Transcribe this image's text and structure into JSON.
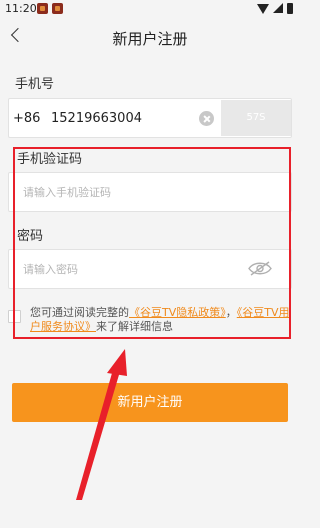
{
  "status_bar": {
    "time": "11:20"
  },
  "nav": {
    "title": "新用户注册"
  },
  "phone": {
    "label": "手机号",
    "country_code": "+86",
    "number": "15219663004",
    "sms_button_label": "57S"
  },
  "verify_code": {
    "label": "手机验证码",
    "placeholder": "请输入手机验证码"
  },
  "password": {
    "label": "密码",
    "placeholder": "请输入密码"
  },
  "agreement": {
    "prefix": "您可通过阅读完整的",
    "privacy_link": "《谷豆TV隐私政策》",
    "separator": "，",
    "service_link": "《谷豆TV用户服务协议》",
    "suffix": "来了解详细信息"
  },
  "register_button": {
    "label": "新用户注册"
  },
  "colors": {
    "accent": "#f7941d",
    "annotation_red": "#e8202a",
    "link": "#f08a1c"
  }
}
